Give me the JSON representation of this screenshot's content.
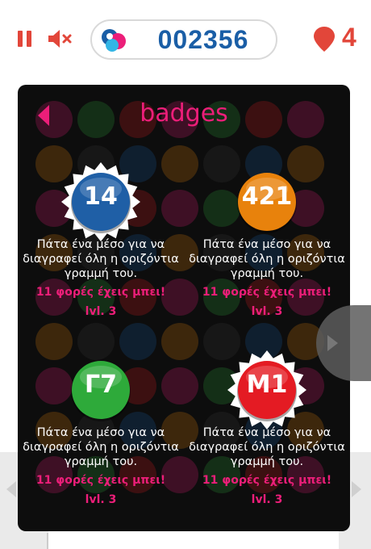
{
  "hud": {
    "score": "002356",
    "lives": "4",
    "pause_icon": "pause-icon",
    "mute_icon": "speaker-muted-icon",
    "lives_icon": "map-pin-icon",
    "accent_color": "#e2463a",
    "score_color": "#1a5ea6"
  },
  "panel": {
    "title": "badges",
    "back_icon": "arrow-left-icon",
    "title_color": "#ec1e79",
    "badges": [
      {
        "code": "14",
        "color": "#1f5fa6",
        "style": "spiked",
        "description_lines": [
          "Πάτα ένα μέσο για να",
          "διαγραφεί όλη η  οριζόντια",
          "γραμμή του."
        ],
        "count": "11 φορές έχεις μπει!",
        "level": "lvl. 3"
      },
      {
        "code": "421",
        "color": "#e8820c",
        "style": "plain",
        "description_lines": [
          "Πάτα ένα μέσο για να",
          "διαγραφεί όλη η  οριζόντια",
          "γραμμή του."
        ],
        "count": "11 φορές έχεις μπει!",
        "level": "lvl. 3"
      },
      {
        "code": "Γ7",
        "color": "#2eaa3a",
        "style": "plain",
        "description_lines": [
          "Πάτα ένα μέσο για να",
          "διαγραφεί όλη η  οριζόντια",
          "γραμμή του."
        ],
        "count": "11 φορές έχεις μπει!",
        "level": "lvl. 3"
      },
      {
        "code": "Μ1",
        "color": "#e41b23",
        "style": "spiked",
        "description_lines": [
          "Πάτα ένα μέσο για να",
          "διαγραφεί όλη η  οριζόντια",
          "γραμμή του."
        ],
        "count": "11 φορές έχεις μπει!",
        "level": "lvl. 3"
      }
    ]
  },
  "next_icon": "chevron-right-icon"
}
